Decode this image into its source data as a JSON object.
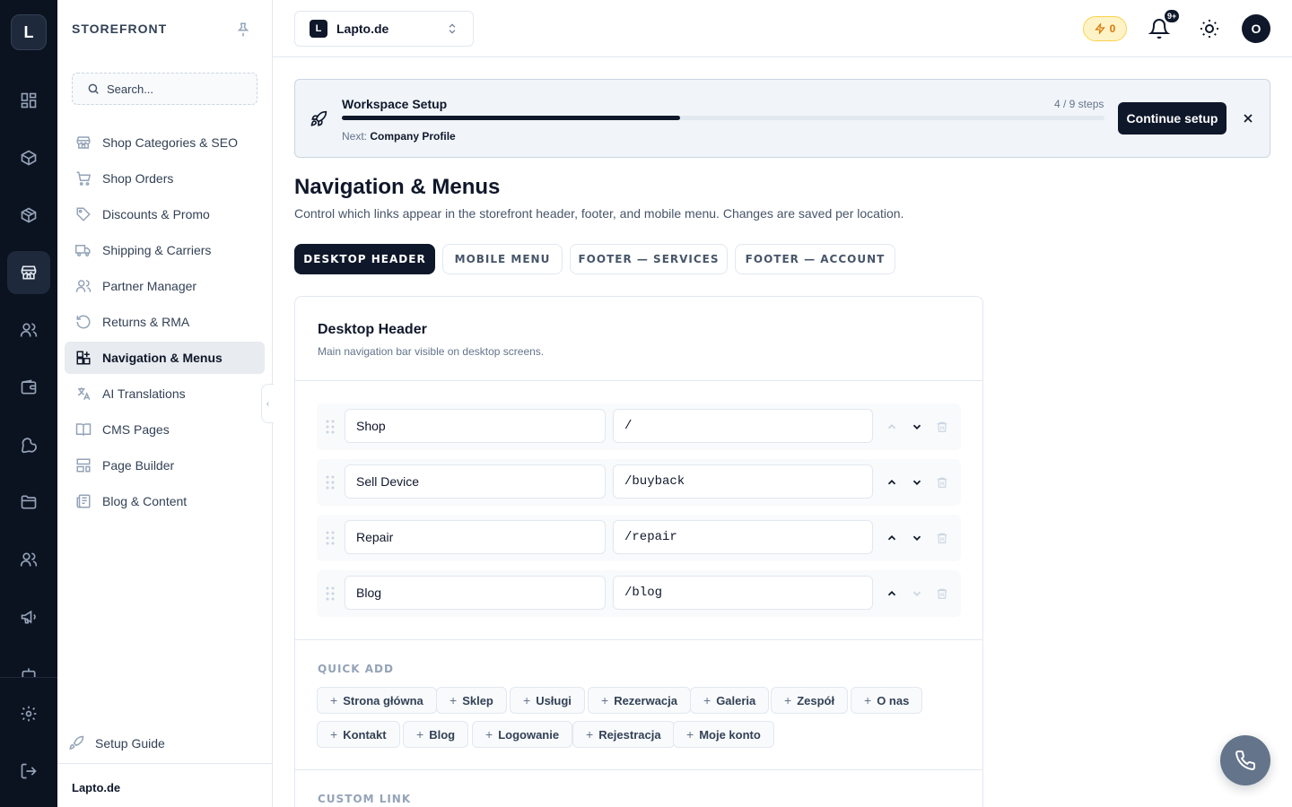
{
  "rail": {
    "logo": "L",
    "items": [
      "dashboard-icon",
      "box-icon",
      "package-icon",
      "store-icon",
      "users-icon",
      "wallet-icon",
      "wrench-icon",
      "folder-icon",
      "team-icon",
      "megaphone-icon",
      "robot-icon",
      "settings-icon",
      "logout-icon"
    ],
    "active": "store-icon"
  },
  "sidebar": {
    "title": "STOREFRONT",
    "search_placeholder": "Search...",
    "items": [
      {
        "label": "Shop Categories & SEO",
        "icon": "store-icon"
      },
      {
        "label": "Shop Orders",
        "icon": "cart-icon"
      },
      {
        "label": "Discounts & Promo",
        "icon": "tag-icon"
      },
      {
        "label": "Shipping & Carriers",
        "icon": "truck-icon"
      },
      {
        "label": "Partner Manager",
        "icon": "users-icon"
      },
      {
        "label": "Returns & RMA",
        "icon": "rotate-ccw-icon"
      },
      {
        "label": "Navigation & Menus",
        "icon": "layout-grid-icon",
        "active": true
      },
      {
        "label": "AI Translations",
        "icon": "languages-icon"
      },
      {
        "label": "CMS Pages",
        "icon": "book-open-icon"
      },
      {
        "label": "Page Builder",
        "icon": "layout-template-icon"
      },
      {
        "label": "Blog & Content",
        "icon": "newspaper-icon"
      }
    ],
    "setup_guide": "Setup Guide",
    "workspace_name": "Lapto.de"
  },
  "topbar": {
    "workspace_badge": "L",
    "workspace_name": "Lapto.de",
    "credits": "0",
    "notifications_badge": "9+",
    "avatar": "O"
  },
  "banner": {
    "title": "Workspace Setup",
    "steps": "4 / 9 steps",
    "progress": 0.444,
    "next_label": "Next:",
    "next_value": "Company Profile",
    "cta": "Continue setup"
  },
  "page": {
    "title": "Navigation & Menus",
    "subtitle": "Control which links appear in the storefront header, footer, and mobile menu. Changes are saved per location."
  },
  "tabs": [
    "DESKTOP HEADER",
    "MOBILE MENU",
    "FOOTER — SERVICES",
    "FOOTER — ACCOUNT"
  ],
  "card": {
    "title": "Desktop Header",
    "subtitle": "Main navigation bar visible on desktop screens.",
    "rows": [
      {
        "label": "Shop",
        "url": "/",
        "up_enabled": false,
        "down_enabled": true
      },
      {
        "label": "Sell Device",
        "url": "/buyback",
        "up_enabled": true,
        "down_enabled": true
      },
      {
        "label": "Repair",
        "url": "/repair",
        "up_enabled": true,
        "down_enabled": true
      },
      {
        "label": "Blog",
        "url": "/blog",
        "up_enabled": true,
        "down_enabled": false
      }
    ],
    "quick_add_label": "QUICK ADD",
    "quick_add": [
      "Strona główna",
      "Sklep",
      "Usługi",
      "Rezerwacja",
      "Galeria",
      "Zespół",
      "O nas",
      "Kontakt",
      "Blog",
      "Logowanie",
      "Rejestracja",
      "Moje konto"
    ],
    "custom_link_label": "CUSTOM LINK"
  }
}
